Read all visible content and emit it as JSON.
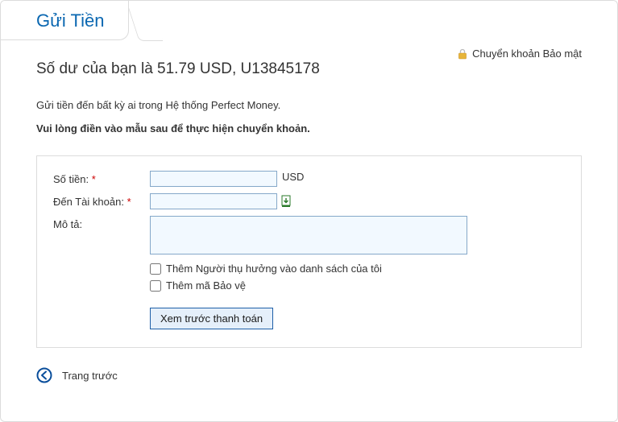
{
  "tab": {
    "title": "Gửi Tiền"
  },
  "balance_line": "Số dư của bạn là 51.79 USD, U13845178",
  "secure_label": "Chuyển khoản Bảo mật",
  "intro": "Gửi tiền đến bất kỳ ai trong Hệ thống Perfect Money.",
  "instruction": "Vui lòng điền vào mẫu sau để thực hiện chuyển khoản.",
  "form": {
    "amount_label": "Số tiền:",
    "amount_unit": "USD",
    "to_account_label": "Đến Tài khoản:",
    "memo_label": "Mô tả:",
    "add_payee_label": "Thêm Người thụ hưởng vào danh sách của tôi",
    "add_protection_label": "Thêm mã Bảo vệ",
    "submit_label": "Xem trước thanh toán",
    "required_mark": "*"
  },
  "back_label": "Trang trước"
}
